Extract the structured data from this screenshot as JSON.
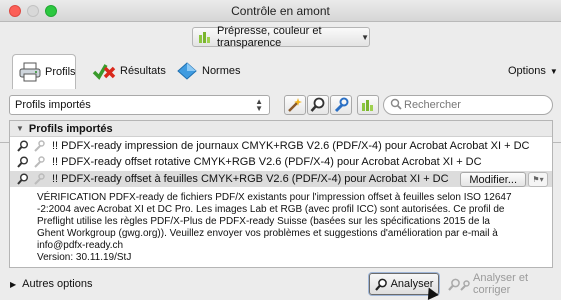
{
  "window": {
    "title": "Contrôle en amont"
  },
  "category_dropdown": {
    "label": "Prépresse, couleur et transparence"
  },
  "tabs": [
    {
      "label": "Profils"
    },
    {
      "label": "Résultats"
    },
    {
      "label": "Normes"
    }
  ],
  "options_label": "Options",
  "filter": {
    "selected": "Profils importés",
    "search_placeholder": "Rechercher"
  },
  "list": {
    "group_label": "Profils importés",
    "rows": [
      {
        "label": "!! PDFX-ready impression de journaux CMYK+RGB V2.6 (PDF/X-4) pour Acrobat Acrobat XI + DC"
      },
      {
        "label": "!! PDFX-ready offset rotative CMYK+RGB V2.6 (PDF/X-4) pour Acrobat Acrobat XI + DC"
      },
      {
        "label": "!! PDFX-ready offset à feuilles CMYK+RGB V2.6 (PDF/X-4) pour Acrobat XI + DC"
      }
    ],
    "modify_label": "Modifier...",
    "description": {
      "line1": "VÉRIFICATION PDFX-ready de fichiers PDF/X existants pour l'impression offset à feuilles selon ISO 12647",
      "line2": "-2:2004 avec Acrobat XI et DC Pro. Les images Lab et RGB (avec profil ICC) sont autorisées. Ce profil de",
      "line3": "Preflight utilise les règles PDF/X-Plus de PDFX-ready Suisse (basées sur les spécifications 2015 de la",
      "line4": "Ghent Workgroup (gwg.org)). Veuillez envoyer vos problèmes et suggestions d'amélioration par e-mail à",
      "line5": "info@pdfx-ready.ch",
      "version": "Version: 30.11.19/StJ"
    }
  },
  "bottom": {
    "other_options": "Autres options",
    "analyze": "Analyser",
    "analyze_fix": "Analyser et corriger"
  },
  "colors": {
    "close": "#fc5f57",
    "maximize": "#2cc840",
    "selection": "#dcdcdc"
  }
}
